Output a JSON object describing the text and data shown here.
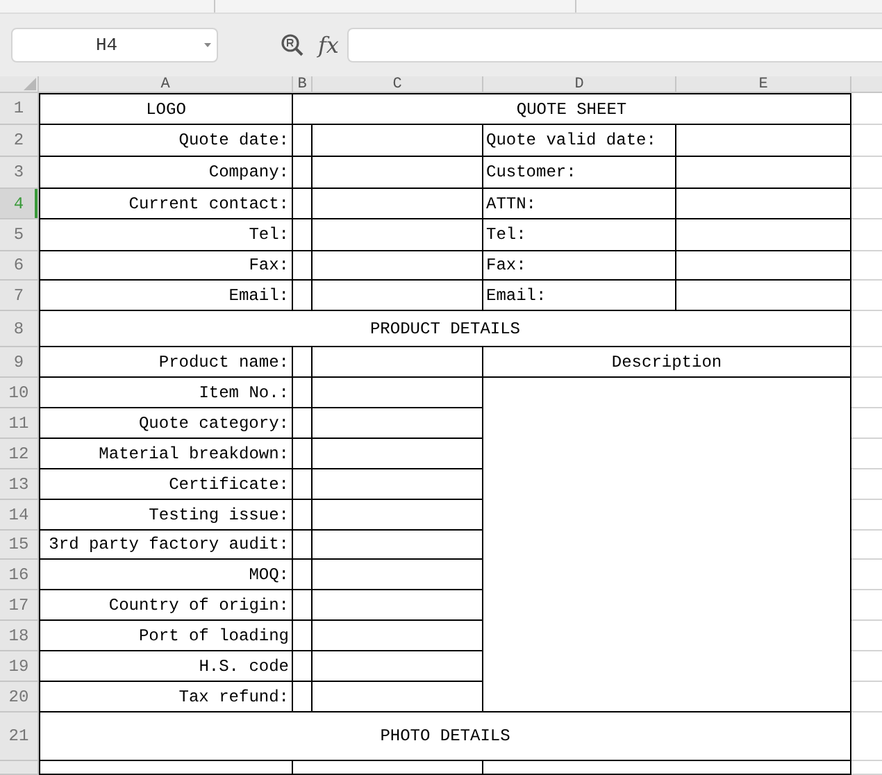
{
  "toolbar": {
    "name_box": "H4",
    "formula_label": "fx"
  },
  "columns": [
    {
      "label": "A"
    },
    {
      "label": "B"
    },
    {
      "label": "C"
    },
    {
      "label": "D"
    },
    {
      "label": "E"
    }
  ],
  "rows": [
    {
      "number": "1",
      "selected": false,
      "kind": "title",
      "cells": [
        "LOGO",
        "QUOTE SHEET"
      ]
    },
    {
      "number": "2",
      "selected": false,
      "kind": "contact",
      "cells": [
        "Quote date:",
        "Quote valid date:"
      ]
    },
    {
      "number": "3",
      "selected": false,
      "kind": "contact",
      "cells": [
        "Company:",
        "Customer:"
      ]
    },
    {
      "number": "4",
      "selected": true,
      "kind": "contact",
      "cells": [
        "Current contact:",
        "ATTN:"
      ]
    },
    {
      "number": "5",
      "selected": false,
      "kind": "contact",
      "cells": [
        "Tel:",
        "Tel:"
      ]
    },
    {
      "number": "6",
      "selected": false,
      "kind": "contact",
      "cells": [
        "Fax:",
        "Fax:"
      ]
    },
    {
      "number": "7",
      "selected": false,
      "kind": "contact",
      "cells": [
        "Email:",
        "Email:"
      ]
    },
    {
      "number": "8",
      "selected": false,
      "kind": "section",
      "cells": [
        "PRODUCT DETAILS"
      ]
    },
    {
      "number": "9",
      "selected": false,
      "kind": "product_head",
      "cells": [
        "Product name:",
        "Description"
      ]
    },
    {
      "number": "10",
      "selected": false,
      "kind": "product",
      "cells": [
        "Item No.:"
      ]
    },
    {
      "number": "11",
      "selected": false,
      "kind": "product",
      "cells": [
        "Quote category:"
      ]
    },
    {
      "number": "12",
      "selected": false,
      "kind": "product",
      "cells": [
        "Material breakdown:"
      ]
    },
    {
      "number": "13",
      "selected": false,
      "kind": "product",
      "cells": [
        "Certificate:"
      ]
    },
    {
      "number": "14",
      "selected": false,
      "kind": "product",
      "cells": [
        "Testing issue:"
      ]
    },
    {
      "number": "15",
      "selected": false,
      "kind": "product",
      "cells": [
        "3rd party factory audit:"
      ]
    },
    {
      "number": "16",
      "selected": false,
      "kind": "product",
      "cells": [
        "MOQ:"
      ]
    },
    {
      "number": "17",
      "selected": false,
      "kind": "product",
      "cells": [
        "Country of origin:"
      ]
    },
    {
      "number": "18",
      "selected": false,
      "kind": "product",
      "cells": [
        "Port of loading"
      ]
    },
    {
      "number": "19",
      "selected": false,
      "kind": "product",
      "cells": [
        "H.S. code"
      ]
    },
    {
      "number": "20",
      "selected": false,
      "kind": "product",
      "cells": [
        "Tax refund:"
      ]
    },
    {
      "number": "21",
      "selected": false,
      "kind": "section",
      "cells": [
        "PHOTO DETAILS"
      ]
    },
    {
      "selected": false,
      "kind": "photo",
      "cells": []
    }
  ]
}
